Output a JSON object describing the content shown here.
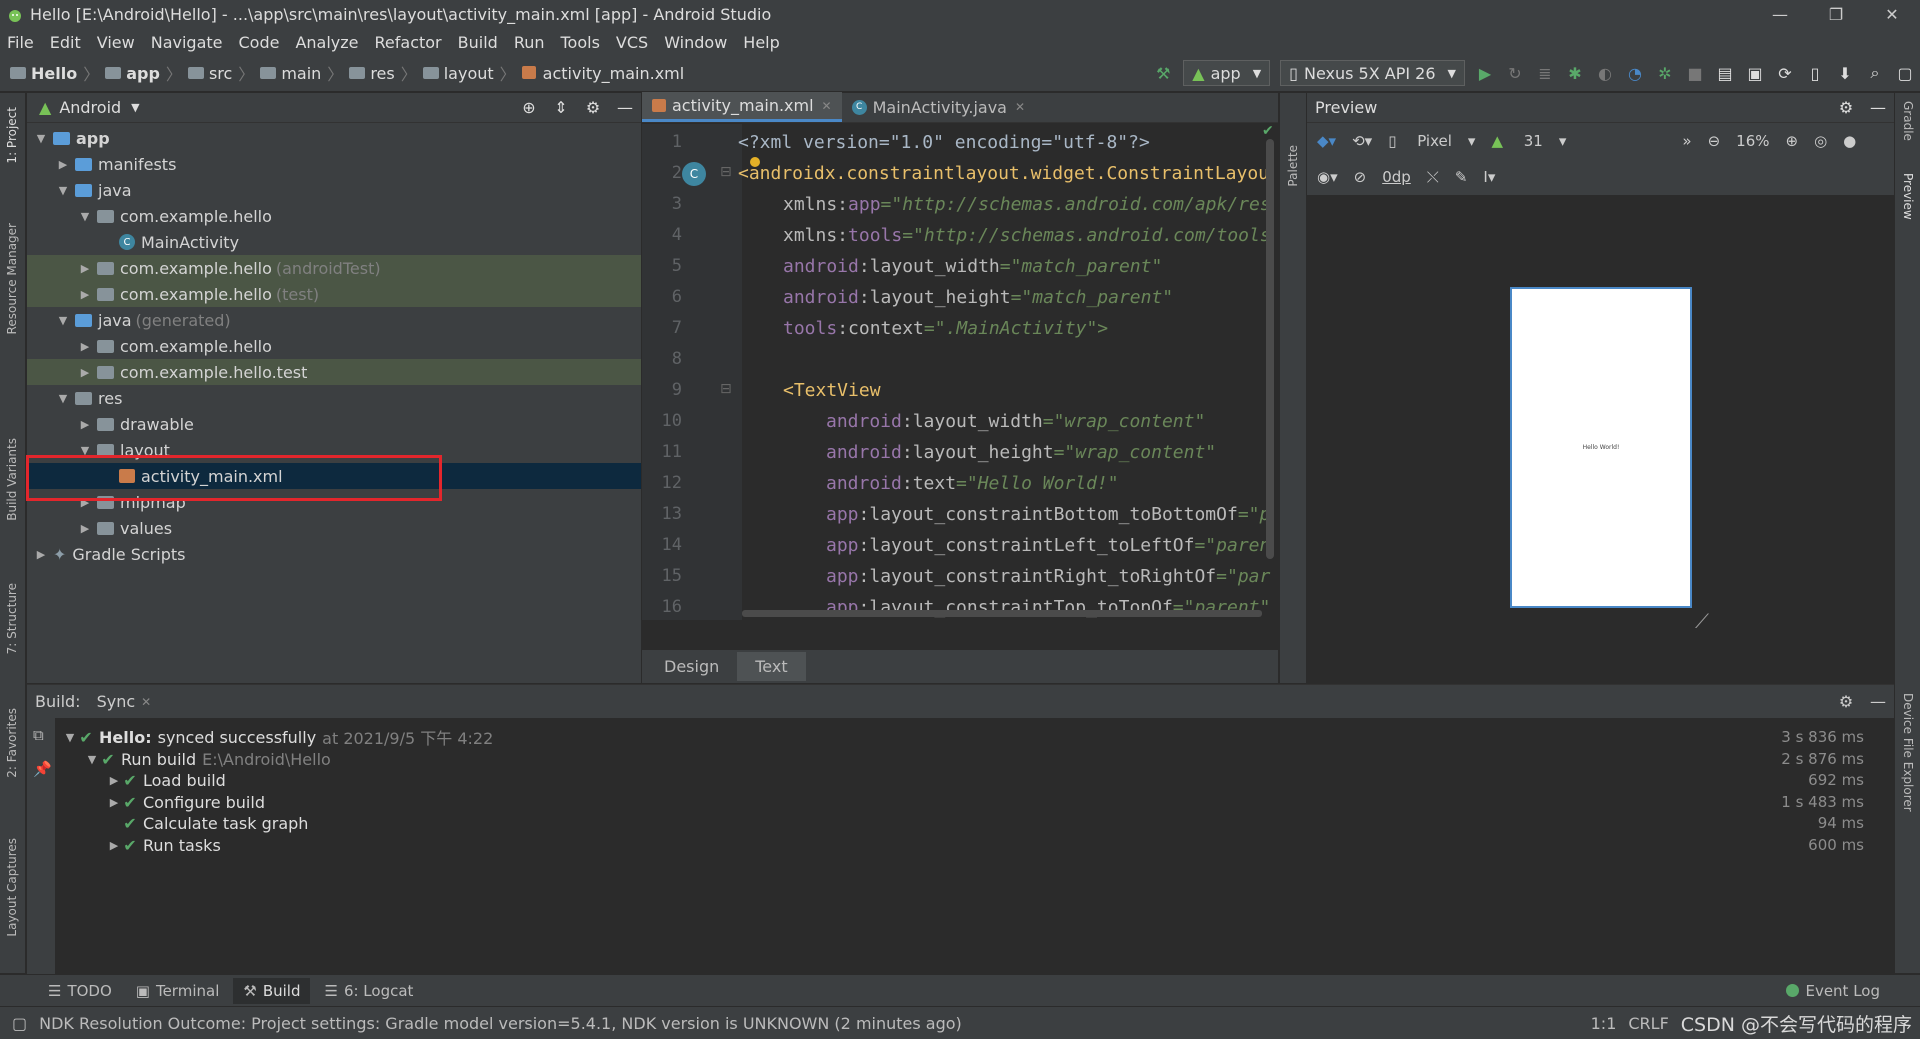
{
  "title_bar": {
    "title": "Hello [E:\\Android\\Hello] - ...\\app\\src\\main\\res\\layout\\activity_main.xml [app] - Android Studio",
    "minimize": "—",
    "restore": "❐",
    "close": "✕"
  },
  "menu": [
    "File",
    "Edit",
    "View",
    "Navigate",
    "Code",
    "Analyze",
    "Refactor",
    "Build",
    "Run",
    "Tools",
    "VCS",
    "Window",
    "Help"
  ],
  "breadcrumbs": [
    "Hello",
    "app",
    "src",
    "main",
    "res",
    "layout",
    "activity_main.xml"
  ],
  "toolbar": {
    "run_config": "app",
    "device": "Nexus 5X API 26"
  },
  "left_strip": {
    "project": "1: Project",
    "resource_manager": "Resource Manager",
    "build_variants": "Build Variants",
    "structure": "7: Structure",
    "favorites": "2: Favorites",
    "layout_captures": "Layout Captures"
  },
  "right_strip": {
    "gradle": "Gradle",
    "preview": "Preview",
    "device_file_explorer": "Device File Explorer"
  },
  "project_panel": {
    "view_mode": "Android",
    "tree": [
      {
        "label": "app",
        "suffix": ""
      },
      {
        "label": "manifests",
        "suffix": ""
      },
      {
        "label": "java",
        "suffix": ""
      },
      {
        "label": "com.example.hello",
        "suffix": ""
      },
      {
        "label": "MainActivity",
        "suffix": ""
      },
      {
        "label": "com.example.hello",
        "suffix": "(androidTest)"
      },
      {
        "label": "com.example.hello",
        "suffix": "(test)"
      },
      {
        "label": "java",
        "suffix": "(generated)"
      },
      {
        "label": "com.example.hello",
        "suffix": ""
      },
      {
        "label": "com.example.hello.test",
        "suffix": ""
      },
      {
        "label": "res",
        "suffix": ""
      },
      {
        "label": "drawable",
        "suffix": ""
      },
      {
        "label": "layout",
        "suffix": ""
      },
      {
        "label": "activity_main.xml",
        "suffix": ""
      },
      {
        "label": "mipmap",
        "suffix": ""
      },
      {
        "label": "values",
        "suffix": ""
      },
      {
        "label": "Gradle Scripts",
        "suffix": ""
      }
    ]
  },
  "editor": {
    "tabs": [
      "activity_main.xml",
      "MainActivity.java"
    ],
    "line_numbers": [
      "1",
      "2",
      "3",
      "4",
      "5",
      "6",
      "7",
      "8",
      "9",
      "10",
      "11",
      "12",
      "13",
      "14",
      "15",
      "16"
    ],
    "code": {
      "l1": "<?xml version=\"1.0\" encoding=\"utf-8\"?>",
      "l2_tag": "<androidx.constraintlayout.widget.ConstraintLayou",
      "l3_ns": "xmlns:",
      "l3_attr": "app",
      "l3_val": "=\"http://schemas.android.com/apk/res",
      "l4_ns": "xmlns:",
      "l4_attr": "tools",
      "l4_val": "=\"http://schemas.android.com/tools",
      "l5_ns": "android",
      "l5_attr": ":layout_width",
      "l5_val": "=\"match_parent\"",
      "l6_ns": "android",
      "l6_attr": ":layout_height",
      "l6_val": "=\"match_parent\"",
      "l7_ns": "tools",
      "l7_attr": ":context",
      "l7_val": "=\".MainActivity\">",
      "l9_tag": "<TextView",
      "l10_ns": "android",
      "l10_attr": ":layout_width",
      "l10_val": "=\"wrap_content\"",
      "l11_ns": "android",
      "l11_attr": ":layout_height",
      "l11_val": "=\"wrap_content\"",
      "l12_ns": "android",
      "l12_attr": ":text",
      "l12_val": "=\"Hello World!\"",
      "l13_ns": "app",
      "l13_attr": ":layout_constraintBottom_toBottomOf",
      "l13_val": "=\"p",
      "l14_ns": "app",
      "l14_attr": ":layout_constraintLeft_toLeftOf",
      "l14_val": "=\"paren",
      "l15_ns": "app",
      "l15_attr": ":layout_constraintRight_toRightOf",
      "l15_val": "=\"par",
      "l16_ns": "app",
      "l16_attr": ":layout_constraintTop_toTopOf",
      "l16_val": "=\"parent\""
    },
    "bottom_tabs": [
      "Design",
      "Text"
    ]
  },
  "palette_label": "Palette",
  "preview": {
    "title": "Preview",
    "device": "Pixel",
    "api": "31",
    "margin": "0dp",
    "zoom": "16%",
    "device_text": "Hello World!"
  },
  "build": {
    "label": "Build:",
    "tab": "Sync",
    "rows": [
      {
        "title": "Hello:",
        "rest": "synced successfully",
        "muted": "at 2021/9/5 下午 4:22",
        "time": "3 s 836 ms"
      },
      {
        "title": "Run build",
        "rest": "",
        "muted": "E:\\Android\\Hello",
        "time": "2 s 876 ms"
      },
      {
        "title": "Load build",
        "rest": "",
        "muted": "",
        "time": "692 ms"
      },
      {
        "title": "Configure build",
        "rest": "",
        "muted": "",
        "time": "1 s 483 ms"
      },
      {
        "title": "Calculate task graph",
        "rest": "",
        "muted": "",
        "time": "94 ms"
      },
      {
        "title": "Run tasks",
        "rest": "",
        "muted": "",
        "time": "600 ms"
      }
    ]
  },
  "tool_windows": [
    "TODO",
    "Terminal",
    "Build",
    "6: Logcat"
  ],
  "event_log": "Event Log",
  "status": {
    "message": "NDK Resolution Outcome: Project settings: Gradle model version=5.4.1, NDK version is UNKNOWN (2 minutes ago)",
    "position": "1:1",
    "line_sep": "CRLF",
    "watermark": "CSDN @不会写代码的程序"
  },
  "colors": {
    "accent": "#4a88c7",
    "highlight_box": "#e3262c",
    "success": "#59a869"
  }
}
